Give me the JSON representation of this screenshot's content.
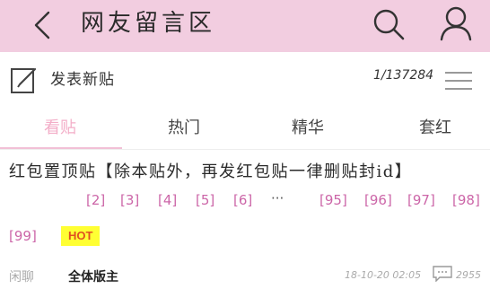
{
  "header": {
    "title": "网友留言区",
    "back_icon": "chevron-left-icon",
    "search_icon": "search-icon",
    "user_icon": "user-icon",
    "background": "#f2cde0"
  },
  "toolbar": {
    "compose_label": "发表新贴",
    "compose_icon": "compose-icon",
    "page_indicator": "1/137284",
    "menu_icon": "menu-icon"
  },
  "tabs": [
    {
      "label": "看贴",
      "active": true
    },
    {
      "label": "热门",
      "active": false
    },
    {
      "label": "精华",
      "active": false
    },
    {
      "label": "套红",
      "active": false
    }
  ],
  "post": {
    "title": "红包置顶贴【除本贴外，再发红包贴一律删贴封id】",
    "pages": [
      "[2]",
      "[3]",
      "[4]",
      "[5]",
      "[6]",
      "[95]",
      "[96]",
      "[97]",
      "[98]",
      "[99]"
    ],
    "ellipsis": "···",
    "hot_badge": "HOT",
    "category": "闲聊",
    "author": "全体版主",
    "time": "18-10-20 02:05",
    "reply_count": "2955",
    "link_color": "#cc66a8",
    "hot_bg": "#ffff33"
  }
}
